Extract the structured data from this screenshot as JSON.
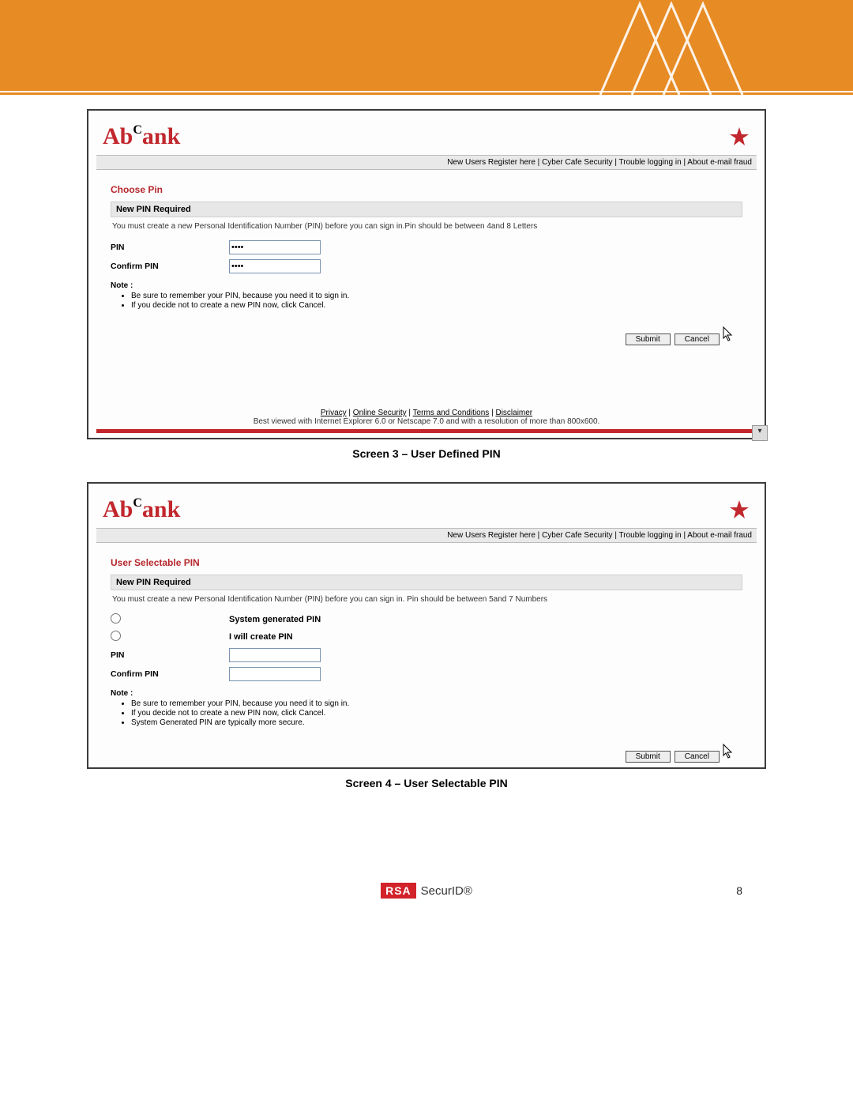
{
  "header": {
    "brand_prefix": "A",
    "brand_mid": "b",
    "brand_sup": "C",
    "brand_suffix": "ank"
  },
  "nav": {
    "items": [
      "New Users Register here",
      "Cyber Cafe Security",
      "Trouble logging in",
      "About e-mail fraud"
    ],
    "sep": " | "
  },
  "screen3": {
    "caption": "Screen 3 – User Defined PIN",
    "title": "Choose Pin",
    "section": "New PIN Required",
    "instruction": "You must create a new Personal Identification Number (PIN) before you can sign in.Pin should be between 4and 8 Letters",
    "pin_label": "PIN",
    "confirm_label": "Confirm PIN",
    "pin_value": "••••",
    "confirm_value": "••••",
    "note_label": "Note :",
    "notes": [
      "Be sure to remember your PIN, because you need it to sign in.",
      "If you decide not to create a new PIN now, click Cancel."
    ],
    "submit": "Submit",
    "cancel": "Cancel",
    "footer_links": [
      "Privacy",
      "Online Security",
      "Terms and Conditions",
      "Disclaimer"
    ],
    "footer_sep": " | ",
    "best_viewed": "Best viewed with Internet Explorer 6.0 or Netscape 7.0 and with a resolution of more than 800x600."
  },
  "screen4": {
    "caption": "Screen 4 – User Selectable PIN",
    "title": "User Selectable PIN",
    "section": "New PIN Required",
    "instruction": "You must create a new Personal Identification Number (PIN) before you can sign in.  Pin should be between 5and 7 Numbers",
    "radio1": "System generated PIN",
    "radio2": "I will create PIN",
    "pin_label": "PIN",
    "confirm_label": "Confirm PIN",
    "note_label": "Note :",
    "notes": [
      "Be sure to remember your PIN, because you need it to sign in.",
      "If you decide not to create a new PIN now, click Cancel.",
      "System Generated PIN are typically more secure."
    ],
    "submit": "Submit",
    "cancel": "Cancel"
  },
  "pagefooter": {
    "rsa_box": "RSA",
    "rsa_text": "SecurID®",
    "page_number": "8"
  }
}
